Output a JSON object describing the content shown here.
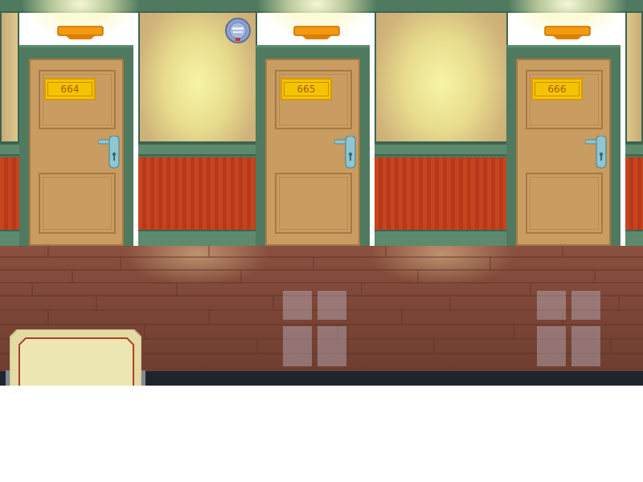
{
  "scene": {
    "doors": [
      {
        "number": "664"
      },
      {
        "number": "665"
      },
      {
        "number": "666"
      }
    ],
    "colors": {
      "wall_trim": "#4f7a5f",
      "wall_stripe": "#c8441f",
      "door": "#c99c62",
      "plate": "#f5c400",
      "floor": "#7c4636",
      "lamp": "#f39a0e"
    },
    "icons": {
      "badge": "round-blue-emblem-icon",
      "lamp": "wall-lamp-icon",
      "handle": "door-handle-icon"
    }
  }
}
